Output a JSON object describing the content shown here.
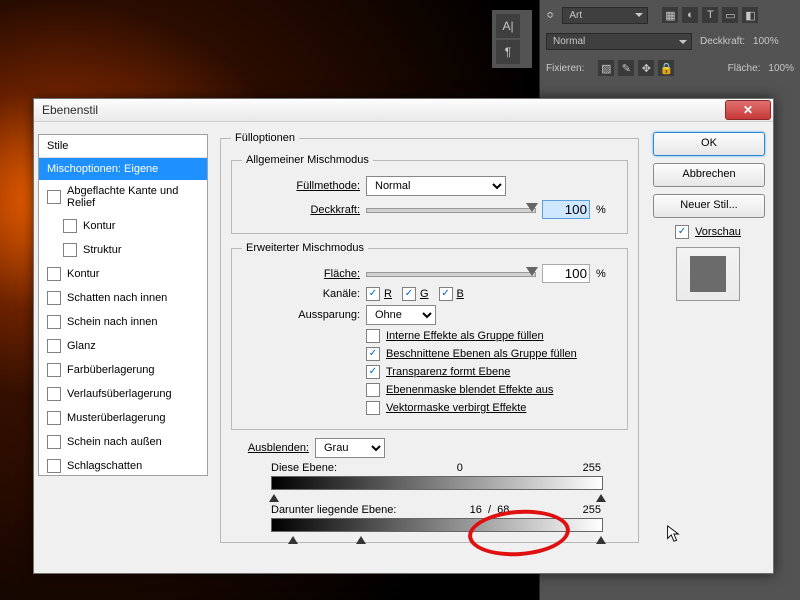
{
  "ps": {
    "art_label": "Art",
    "blendmode": "Normal",
    "opacity_label": "Deckkraft:",
    "opacity_value": "100%",
    "fix_label": "Fixieren:",
    "fill_label": "Fläche:",
    "fill_value": "100%"
  },
  "dialog": {
    "title": "Ebenenstil"
  },
  "sidebar": {
    "header": "Stile",
    "items": [
      {
        "label": "Mischoptionen: Eigene"
      },
      {
        "label": "Abgeflachte Kante und Relief"
      },
      {
        "label": "Kontur"
      },
      {
        "label": "Struktur"
      },
      {
        "label": "Kontur"
      },
      {
        "label": "Schatten nach innen"
      },
      {
        "label": "Schein nach innen"
      },
      {
        "label": "Glanz"
      },
      {
        "label": "Farbüberlagerung"
      },
      {
        "label": "Verlaufsüberlagerung"
      },
      {
        "label": "Musterüberlagerung"
      },
      {
        "label": "Schein nach außen"
      },
      {
        "label": "Schlagschatten"
      }
    ]
  },
  "main": {
    "fill_title": "Fülloptionen",
    "general_title": "Allgemeiner Mischmodus",
    "fill_method_label": "Füllmethode:",
    "fill_method_value": "Normal",
    "opacity_label": "Deckkraft:",
    "opacity_value": "100",
    "percent": "%",
    "advanced_title": "Erweiterter Mischmodus",
    "fill_label": "Fläche:",
    "fill_value": "100",
    "channels_label": "Kanäle:",
    "ch_r": "R",
    "ch_g": "G",
    "ch_b": "B",
    "knockout_label": "Aussparung:",
    "knockout_value": "Ohne",
    "cb1": "Interne Effekte als Gruppe füllen",
    "cb2": "Beschnittene Ebenen als Gruppe füllen",
    "cb3": "Transparenz formt Ebene",
    "cb4": "Ebenenmaske blendet Effekte aus",
    "cb5": "Vektormaske verbirgt Effekte",
    "blendif_label": "Ausblenden:",
    "blendif_value": "Grau",
    "this_layer": "Diese Ebene:",
    "this_lo": "0",
    "this_hi": "255",
    "under_layer": "Darunter liegende Ebene:",
    "under_lo": "16",
    "under_sep": "/",
    "under_lo2": "68",
    "under_hi": "255"
  },
  "buttons": {
    "ok": "OK",
    "cancel": "Abbrechen",
    "newstyle": "Neuer Stil...",
    "preview": "Vorschau"
  }
}
